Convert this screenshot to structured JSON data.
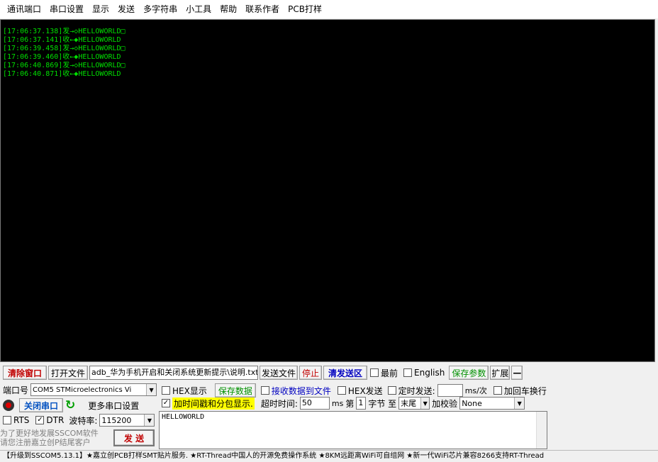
{
  "menu": [
    "通讯端口",
    "串口设置",
    "显示",
    "发送",
    "多字符串",
    "小工具",
    "帮助",
    "联系作者",
    "PCB打样"
  ],
  "log": [
    "[17:06:37.138]发→◇HELLOWORLD□",
    "[17:06:37.141]收←◆HELLOWORLD",
    "[17:06:39.458]发→◇HELLOWORLD□",
    "[17:06:39.460]收←◆HELLOWORLD",
    "[17:06:40.869]发→◇HELLOWORLD□",
    "[17:06:40.871]收←◆HELLOWORLD"
  ],
  "toolbar": {
    "clear": "清除窗口",
    "open_file": "打开文件",
    "file_path": "adb_华为手机开启和关闭系统更新提示\\说明.txt",
    "send_file": "发送文件",
    "stop": "停止",
    "clear_send": "清发送区",
    "topmost": "最前",
    "english": "English",
    "save_params": "保存参数",
    "expand": "扩展",
    "collapse": "—"
  },
  "port": {
    "label": "端口号",
    "value": "COM5 STMicroelectronics Vi",
    "close_btn": "关闭串口",
    "more_settings": "更多串口设置",
    "rts": "RTS",
    "dtr": "DTR",
    "baud_label": "波特率:",
    "baud_value": "115200",
    "promo1": "为了更好地发展SSCOM软件",
    "promo2": "请您注册嘉立创P结尾客户",
    "send_btn": "发 送"
  },
  "options": {
    "hex_display": "HEX显示",
    "save_data": "保存数据",
    "recv_to_file": "接收数据到文件",
    "hex_send": "HEX发送",
    "timed_send": "定时发送:",
    "timed_unit": "ms/次",
    "add_crlf": "加回车换行",
    "timestamp": "加时间戳和分包显示.",
    "timeout_label": "超时时间:",
    "timeout_value": "50",
    "timeout_unit": "ms",
    "nth_label": "第",
    "nth_value": "1",
    "byte_label": "字节 至",
    "end_value": "末尾",
    "checksum_label": "加校验",
    "checksum_value": "None"
  },
  "send_text": "HELLOWORLD",
  "status": "【升级到SSCOM5.13.1】★嘉立创PCB打样SMT贴片服务. ★RT-Thread中国人的开源免费操作系统 ★8KM远距离WiFi可自组网 ★新一代WiFi芯片兼容8266支持RT-Thread"
}
